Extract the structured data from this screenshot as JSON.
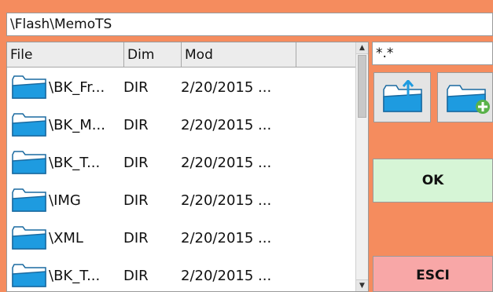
{
  "path": "\\Flash\\MemoTS",
  "filter": "*.*",
  "columns": {
    "file": "File",
    "dim": "Dim",
    "mod": "Mod"
  },
  "rows": [
    {
      "name": "\\BK_Fr...",
      "dim": "DIR",
      "mod": "2/20/2015 ..."
    },
    {
      "name": "\\BK_M...",
      "dim": "DIR",
      "mod": "2/20/2015 ..."
    },
    {
      "name": "\\BK_T...",
      "dim": "DIR",
      "mod": "2/20/2015 ..."
    },
    {
      "name": "\\IMG",
      "dim": "DIR",
      "mod": "2/20/2015 ..."
    },
    {
      "name": "\\XML",
      "dim": "DIR",
      "mod": "2/20/2015 ..."
    },
    {
      "name": "\\BK_T...",
      "dim": "DIR",
      "mod": "2/20/2015 ..."
    }
  ],
  "buttons": {
    "ok": "OK",
    "esci": "ESCI"
  },
  "icons": {
    "row_icon": "folder-icon",
    "up_button": "folder-up-icon",
    "new_button": "new-folder-icon"
  },
  "colors": {
    "background": "#f58c5e",
    "folder": "#1e9be0",
    "ok": "#d6f5d6",
    "esci": "#f8a7a7"
  }
}
